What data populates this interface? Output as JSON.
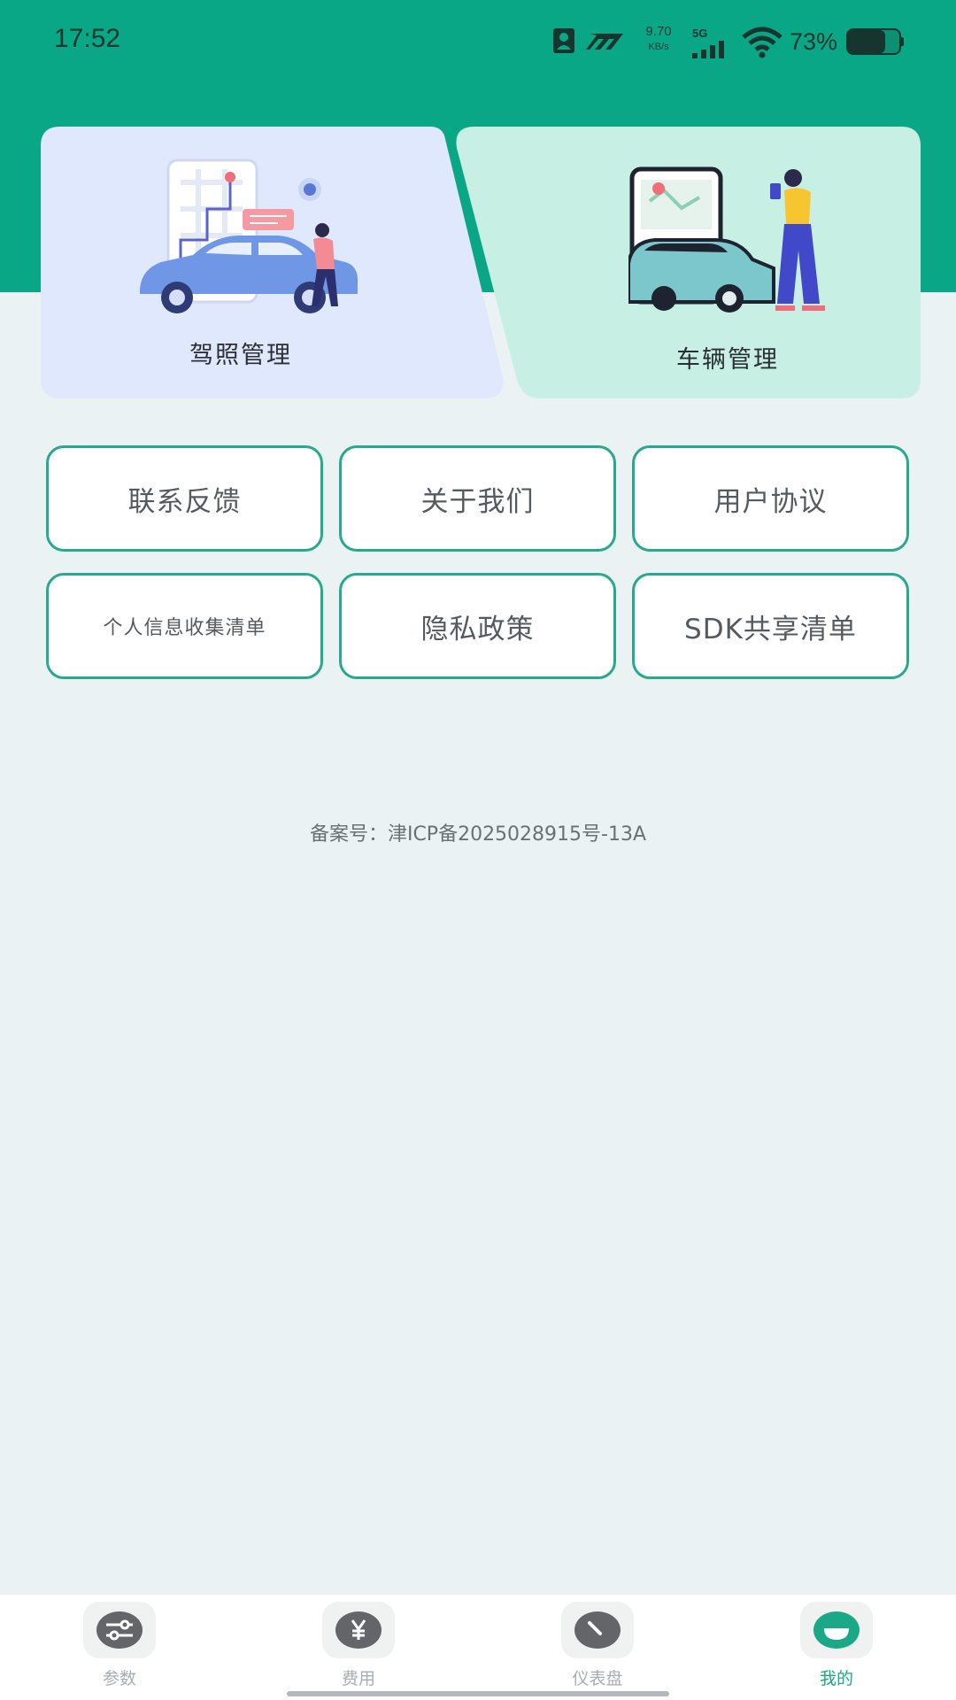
{
  "status_bar": {
    "time": "17:52",
    "net_speed_value": "9.70",
    "net_speed_unit": "KB/s",
    "network_type": "5G",
    "battery_percent": "73%"
  },
  "cards": {
    "license": {
      "label": "驾照管理",
      "bg": "#dfe8fc"
    },
    "vehicle": {
      "label": "车辆管理",
      "bg": "#c7efe4"
    }
  },
  "buttons": {
    "feedback": "联系反馈",
    "about": "关于我们",
    "user_agreement": "用户协议",
    "personal_info": "个人信息收集清单",
    "privacy": "隐私政策",
    "sdk_share": "SDK共享清单"
  },
  "icp_text": "备案号：津ICP备2025028915号-13A",
  "bottom_nav": {
    "items": [
      {
        "label": "参数",
        "icon": "sliders-icon"
      },
      {
        "label": "费用",
        "icon": "yen-icon"
      },
      {
        "label": "仪表盘",
        "icon": "gauge-icon"
      },
      {
        "label": "我的",
        "icon": "profile-icon",
        "active": true
      }
    ]
  },
  "colors": {
    "brand_green": "#0aa786",
    "button_border": "#27a98d",
    "active_nav": "#1aa887"
  }
}
